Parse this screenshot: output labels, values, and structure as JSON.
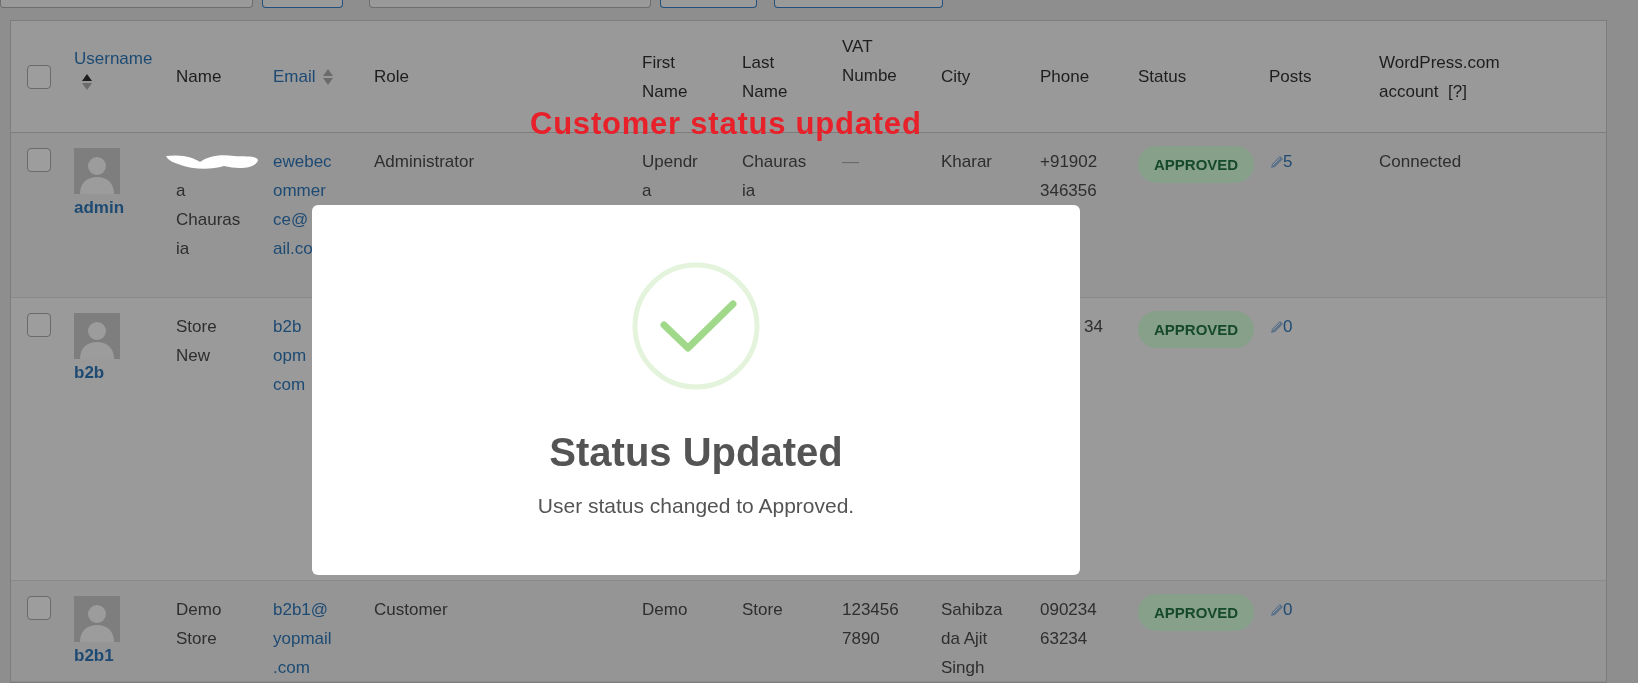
{
  "top_controls": [
    {
      "kind": "field"
    },
    {
      "kind": "button"
    },
    {
      "kind": "field"
    },
    {
      "kind": "button"
    },
    {
      "kind": "button"
    }
  ],
  "annotation": "Customer status updated",
  "table": {
    "select_all_checked": false,
    "columns": [
      {
        "lines": [
          "Username"
        ],
        "sortable": true,
        "sorted": true
      },
      {
        "lines": [
          "Name"
        ]
      },
      {
        "lines": [
          "Email"
        ],
        "sortable": true,
        "sorted": false
      },
      {
        "lines": [
          "Role"
        ]
      },
      {
        "lines": [
          "First",
          "Name"
        ]
      },
      {
        "lines": [
          "Last",
          "Name"
        ]
      },
      {
        "lines": [
          "VAT",
          "Numbe"
        ]
      },
      {
        "lines": [
          "City"
        ]
      },
      {
        "lines": [
          "Phone"
        ]
      },
      {
        "lines": [
          "Status"
        ]
      },
      {
        "lines": [
          "Posts"
        ]
      },
      {
        "lines": [
          "WordPress.com",
          "account  [?]"
        ]
      }
    ],
    "rows": [
      {
        "checked": false,
        "username": "admin",
        "name": [
          "a",
          "Chauras",
          "ia"
        ],
        "name_redacted": true,
        "email": [
          "ewebec",
          "ommer",
          "ce@",
          "ail.co"
        ],
        "role": "Administrator",
        "first_name": [
          "Upendr",
          "a"
        ],
        "last_name": [
          "Chauras",
          "ia"
        ],
        "vat": [
          "—"
        ],
        "city": [
          "Kharar"
        ],
        "phone": [
          "+91902",
          "346356"
        ],
        "phone_covered": false,
        "status": "APPROVED",
        "posts": "5",
        "wordpress": "Connected"
      },
      {
        "checked": false,
        "username": "b2b",
        "name": [
          "Store",
          "New"
        ],
        "name_redacted": false,
        "email": [
          "b2b",
          "opm",
          "com"
        ],
        "phone": [
          "34"
        ],
        "phone_covered": true,
        "status": "APPROVED",
        "posts": "0"
      },
      {
        "checked": false,
        "username": "b2b1",
        "name": [
          "Demo",
          "Store"
        ],
        "name_redacted": false,
        "email": [
          "b2b1@",
          "yopmail",
          ".com"
        ],
        "role": "Customer",
        "first_name": [
          "Demo"
        ],
        "last_name": [
          "Store"
        ],
        "vat": [
          "123456",
          "7890"
        ],
        "city": [
          "Sahibza",
          "da Ajit",
          "Singh"
        ],
        "phone": [
          "090234",
          "63234"
        ],
        "phone_covered": false,
        "status": "APPROVED",
        "posts": "0"
      }
    ]
  },
  "modal": {
    "title": "Status Updated",
    "message": "User status changed to Approved."
  }
}
